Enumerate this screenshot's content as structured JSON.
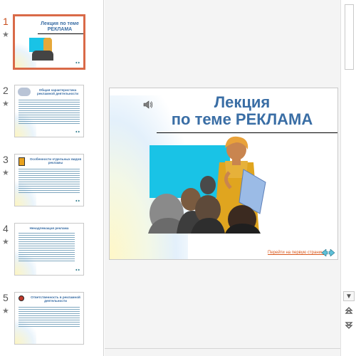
{
  "thumbnails": [
    {
      "number": "1",
      "title": "Лекция по теме РЕКЛАМА",
      "active": true
    },
    {
      "number": "2",
      "title": "Общая характеристика рекламной деятельности",
      "active": false
    },
    {
      "number": "3",
      "title": "Особенности отдельных видов рекламы",
      "active": false
    },
    {
      "number": "4",
      "title": "Ненадлежащая реклама",
      "active": false
    },
    {
      "number": "5",
      "title": "Ответственность в рекламной деятельности",
      "active": false
    }
  ],
  "thumb_star": "★",
  "slide": {
    "title_line1": "Лекция",
    "title_line2": "по теме РЕКЛАМА",
    "nav_link": "Перейти на первую страницу"
  },
  "scrollbar": {
    "down_arrow": "▼",
    "prev_slide": "⯭",
    "next_slide": "⯯"
  },
  "colors": {
    "title": "#3a6ea5",
    "active_thumb_border": "#d96a48",
    "link": "#d9571b"
  }
}
